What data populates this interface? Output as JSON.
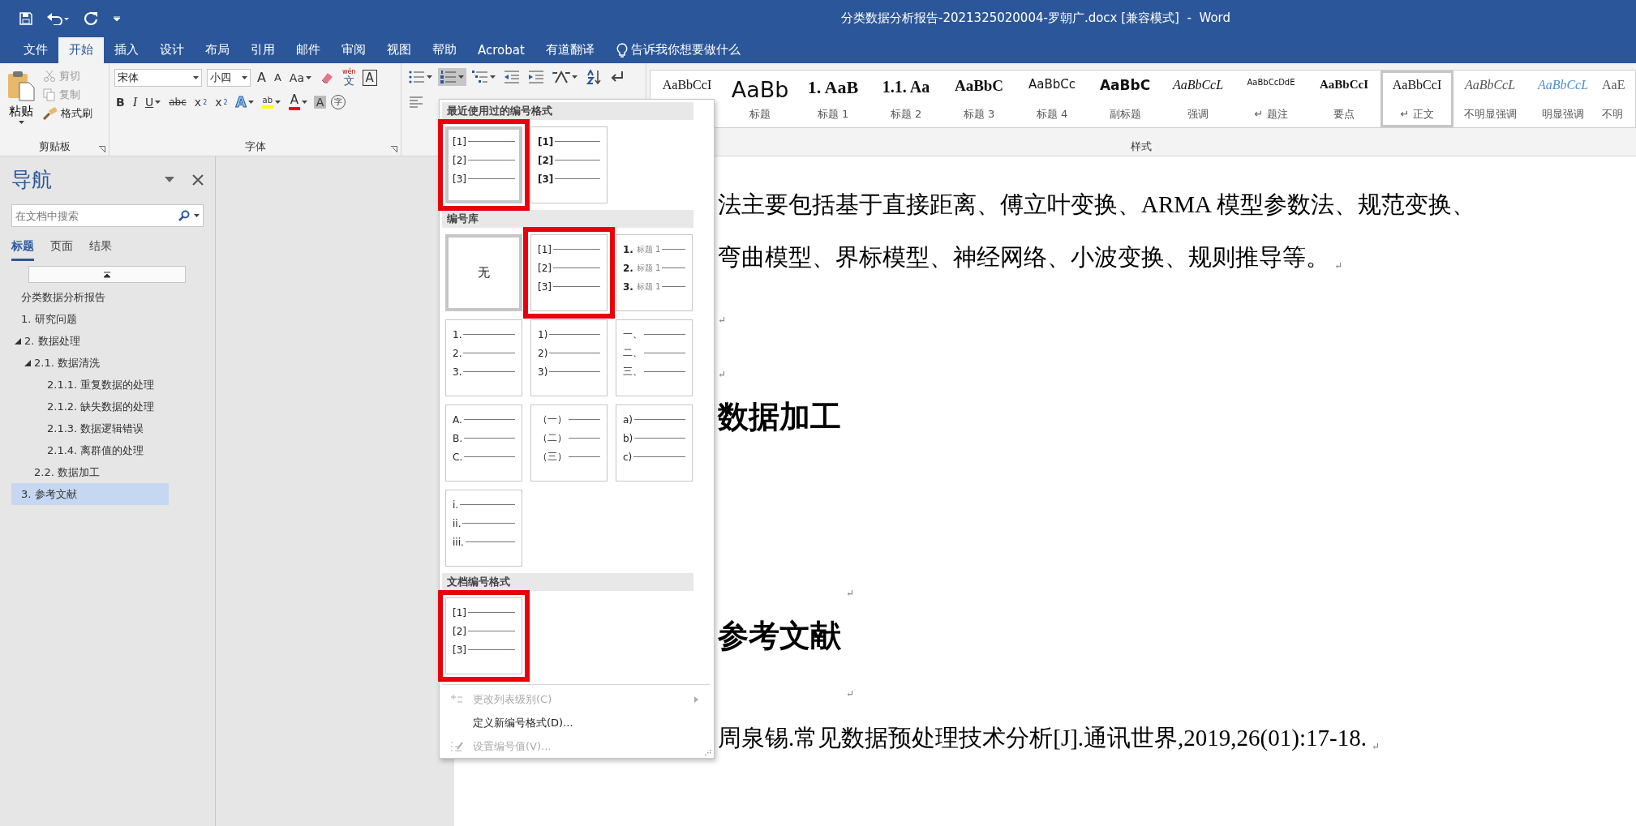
{
  "window": {
    "title": "分类数据分析报告-2021325020004-罗朝广.docx [兼容模式]  -  Word"
  },
  "ribbon_tabs": [
    {
      "label": "文件",
      "selected": false
    },
    {
      "label": "开始",
      "selected": true
    },
    {
      "label": "插入",
      "selected": false
    },
    {
      "label": "设计",
      "selected": false
    },
    {
      "label": "布局",
      "selected": false
    },
    {
      "label": "引用",
      "selected": false
    },
    {
      "label": "邮件",
      "selected": false
    },
    {
      "label": "审阅",
      "selected": false
    },
    {
      "label": "视图",
      "selected": false
    },
    {
      "label": "帮助",
      "selected": false
    },
    {
      "label": "Acrobat",
      "selected": false
    },
    {
      "label": "有道翻译",
      "selected": false
    }
  ],
  "tell_me": {
    "placeholder": "告诉我你想要做什么"
  },
  "clipboard": {
    "paste": "粘贴",
    "group_label": "剪贴板",
    "commands": [
      {
        "kind": "cut",
        "label": "剪切",
        "disabled": true
      },
      {
        "kind": "copy",
        "label": "复制",
        "disabled": true
      },
      {
        "kind": "painter",
        "label": "格式刷",
        "disabled": false
      }
    ]
  },
  "font": {
    "name": "宋体",
    "size": "小四",
    "group_label": "字体",
    "row1": [
      {
        "kind": "grow",
        "glyph": "A"
      },
      {
        "kind": "shrink",
        "glyph": "A"
      },
      {
        "kind": "case",
        "glyph": "Aa"
      },
      {
        "kind": "clear"
      },
      {
        "kind": "phonetic",
        "top": "wén",
        "glyph": "文"
      },
      {
        "kind": "border",
        "glyph": "A"
      }
    ],
    "row2": [
      {
        "kind": "bold",
        "glyph": "B"
      },
      {
        "kind": "italic",
        "glyph": "I"
      },
      {
        "kind": "underline",
        "glyph": "U"
      },
      {
        "kind": "strike",
        "glyph": "abc"
      },
      {
        "kind": "sub",
        "glyph": "x",
        "script": "2"
      },
      {
        "kind": "sup",
        "glyph": "x",
        "script": "2"
      },
      {
        "kind": "effects",
        "glyph": "A"
      },
      {
        "kind": "highlight",
        "glyph": "ab",
        "color": "#ffff00"
      },
      {
        "kind": "fontcolor",
        "glyph": "A",
        "color": "#ff0000"
      },
      {
        "kind": "shading",
        "glyph": "A"
      },
      {
        "kind": "enclose",
        "glyph": "字"
      }
    ]
  },
  "paragraph": {
    "row1": [
      {
        "kind": "bullets",
        "on": false
      },
      {
        "kind": "numbering",
        "on": true
      },
      {
        "kind": "multilevel",
        "on": false
      },
      {
        "kind": "outdent",
        "on": false
      },
      {
        "kind": "indent",
        "on": false
      },
      {
        "kind": "layout",
        "on": false
      },
      {
        "kind": "sort",
        "on": false
      },
      {
        "kind": "marks",
        "on": false
      }
    ],
    "row2": [
      {
        "kind": "align-left",
        "on": false
      }
    ]
  },
  "styles": {
    "group_label": "样式",
    "items": [
      {
        "preview": "AaBbCcI",
        "kind": "serif",
        "selected": false
      },
      {
        "preview": "AaBb",
        "label": "标题",
        "kind": "title",
        "selected": false
      },
      {
        "preview": "1. AaB",
        "label": "标题 1",
        "kind": "h1",
        "selected": false
      },
      {
        "preview": "1.1. Aa",
        "label": "标题 2",
        "kind": "h2",
        "selected": false
      },
      {
        "preview": "AaBbC",
        "label": "标题 3",
        "kind": "h3",
        "selected": false
      },
      {
        "preview": "AaBbCc",
        "label": "标题 4",
        "kind": "sans",
        "selected": false
      },
      {
        "preview": "AaBbC",
        "label": "副标题",
        "kind": "boldsans",
        "selected": false
      },
      {
        "preview": "AaBbCcL",
        "label": "强调",
        "kind": "italic",
        "selected": false
      },
      {
        "preview": "AaBbCcDdE",
        "label": "↵ 题注",
        "kind": "small",
        "selected": false
      },
      {
        "preview": "AaBbCcI",
        "label": "要点",
        "kind": "boldserif",
        "selected": false
      },
      {
        "preview": "AaBbCcI",
        "label": "↵ 正文",
        "kind": "serif",
        "selected": true
      },
      {
        "preview": "AaBbCcL",
        "label": "不明显强调",
        "kind": "grayitalic",
        "selected": false
      },
      {
        "preview": "AaBbCcL",
        "label": "明显强调",
        "kind": "blueitalic",
        "selected": false
      },
      {
        "preview": "AaE",
        "label": "不明",
        "kind": "gray",
        "selected": false
      }
    ]
  },
  "nav": {
    "title": "导航",
    "search": {
      "placeholder": "在文档中搜索"
    },
    "tabs": [
      {
        "label": "标题",
        "selected": true
      },
      {
        "label": "页面",
        "selected": false
      },
      {
        "label": "结果",
        "selected": false
      }
    ],
    "headings": [
      {
        "label": "分类数据分析报告",
        "selected": false
      },
      {
        "label": "1. 研究问题",
        "selected": false
      },
      {
        "label": "2. 数据处理",
        "selected": false,
        "expanded": true,
        "children": [
          {
            "label": "2.1. 数据清洗",
            "selected": false,
            "expanded": true,
            "children": [
              {
                "label": "2.1.1. 重复数据的处理",
                "selected": false
              },
              {
                "label": "2.1.2. 缺失数据的处理",
                "selected": false
              },
              {
                "label": "2.1.3. 数据逻辑错误",
                "selected": false
              },
              {
                "label": "2.1.4. 离群值的处理",
                "selected": false
              }
            ]
          },
          {
            "label": "2.2. 数据加工",
            "selected": false
          }
        ]
      },
      {
        "label": "3. 参考文献",
        "selected": true
      }
    ]
  },
  "document": {
    "blocks": [
      {
        "kind": "line",
        "text": "法主要包括基于直接距离、傅立叶变换、ARMA 模型参数法、规范变换、"
      },
      {
        "kind": "line",
        "text": "弯曲模型、界标模型、神经网络、小波变换、规则推导等。",
        "mark": "↵"
      },
      {
        "kind": "empty",
        "mark": "↵"
      },
      {
        "kind": "empty",
        "mark": "↵"
      },
      {
        "kind": "heading",
        "text": "数据加工",
        "mark": "↵"
      },
      {
        "kind": "heading",
        "text": "参考文献",
        "mark": "↵"
      },
      {
        "kind": "line",
        "text": "周泉锡.常见数据预处理技术分析[J].通讯世界,2019,26(01):17-18.",
        "mark": "↵"
      }
    ]
  },
  "numbering_menu": {
    "sections": [
      {
        "title": "最近使用过的编号格式",
        "tiles": [
          {
            "kind": "list",
            "selected": true,
            "highlighted": true,
            "bold": false,
            "lines": [
              {
                "marker": "[1]"
              },
              {
                "marker": "[2]"
              },
              {
                "marker": "[3]"
              }
            ]
          },
          {
            "kind": "list",
            "selected": false,
            "highlighted": false,
            "bold": true,
            "lines": [
              {
                "marker": "[1]"
              },
              {
                "marker": "[2]"
              },
              {
                "marker": "[3]"
              }
            ]
          }
        ]
      },
      {
        "title": "编号库",
        "tiles": [
          {
            "kind": "none",
            "label": "无",
            "selected": true,
            "highlighted": false
          },
          {
            "kind": "list",
            "selected": false,
            "highlighted": true,
            "bold": false,
            "lines": [
              {
                "marker": "[1]"
              },
              {
                "marker": "[2]"
              },
              {
                "marker": "[3]"
              }
            ]
          },
          {
            "kind": "list",
            "selected": false,
            "highlighted": false,
            "bold": true,
            "lines": [
              {
                "marker": "1.",
                "caption": "标题 1"
              },
              {
                "marker": "2.",
                "caption": "标题 1"
              },
              {
                "marker": "3.",
                "caption": "标题 1"
              }
            ]
          },
          {
            "kind": "list",
            "selected": false,
            "highlighted": false,
            "bold": false,
            "lines": [
              {
                "marker": "1."
              },
              {
                "marker": "2."
              },
              {
                "marker": "3."
              }
            ]
          },
          {
            "kind": "list",
            "selected": false,
            "highlighted": false,
            "bold": false,
            "lines": [
              {
                "marker": "1)"
              },
              {
                "marker": "2)"
              },
              {
                "marker": "3)"
              }
            ]
          },
          {
            "kind": "list",
            "selected": false,
            "highlighted": false,
            "bold": false,
            "lines": [
              {
                "marker": "一、"
              },
              {
                "marker": "二、"
              },
              {
                "marker": "三、"
              }
            ]
          },
          {
            "kind": "list",
            "selected": false,
            "highlighted": false,
            "bold": false,
            "lines": [
              {
                "marker": "A."
              },
              {
                "marker": "B."
              },
              {
                "marker": "C."
              }
            ]
          },
          {
            "kind": "list",
            "selected": false,
            "highlighted": false,
            "bold": false,
            "lines": [
              {
                "marker": "（一）"
              },
              {
                "marker": "（二）"
              },
              {
                "marker": "（三）"
              }
            ]
          },
          {
            "kind": "list",
            "selected": false,
            "highlighted": false,
            "bold": false,
            "lines": [
              {
                "marker": "a)"
              },
              {
                "marker": "b)"
              },
              {
                "marker": "c)"
              }
            ]
          },
          {
            "kind": "list",
            "selected": false,
            "highlighted": false,
            "bold": false,
            "lines": [
              {
                "marker": "i."
              },
              {
                "marker": "ii."
              },
              {
                "marker": "iii."
              }
            ]
          }
        ]
      },
      {
        "title": "文档编号格式",
        "tiles": [
          {
            "kind": "list",
            "selected": false,
            "highlighted": true,
            "bold": false,
            "lines": [
              {
                "marker": "[1]"
              },
              {
                "marker": "[2]"
              },
              {
                "marker": "[3]"
              }
            ]
          }
        ]
      }
    ],
    "commands": [
      {
        "kind": "level",
        "label": "更改列表级别(C)",
        "disabled": true,
        "submenu": true
      },
      {
        "kind": "define",
        "label": "定义新编号格式(D)...",
        "disabled": false,
        "submenu": false
      },
      {
        "kind": "value",
        "label": "设置编号值(V)...",
        "disabled": true,
        "submenu": false
      }
    ]
  }
}
